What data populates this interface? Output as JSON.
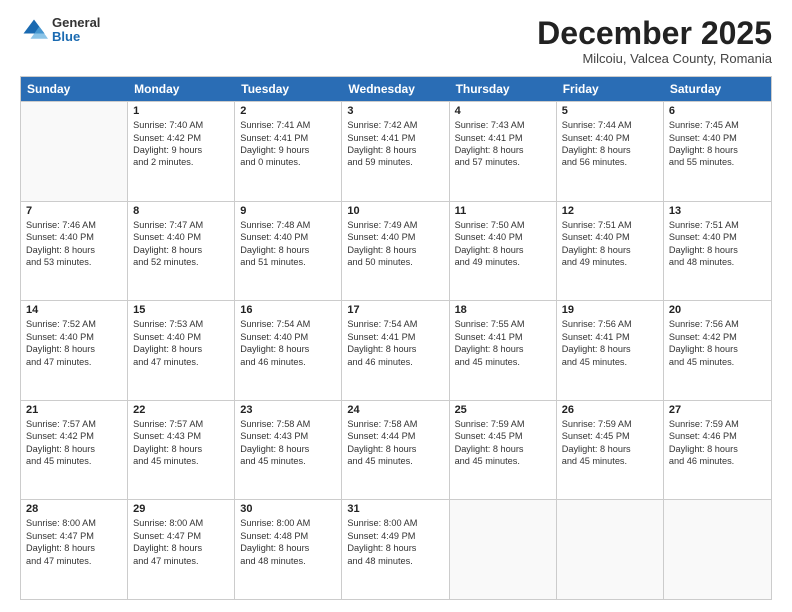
{
  "logo": {
    "general": "General",
    "blue": "Blue"
  },
  "title": "December 2025",
  "subtitle": "Milcoiu, Valcea County, Romania",
  "header_days": [
    "Sunday",
    "Monday",
    "Tuesday",
    "Wednesday",
    "Thursday",
    "Friday",
    "Saturday"
  ],
  "weeks": [
    [
      {
        "day": "",
        "sunrise": "",
        "sunset": "",
        "daylight": ""
      },
      {
        "day": "1",
        "sunrise": "Sunrise: 7:40 AM",
        "sunset": "Sunset: 4:42 PM",
        "daylight": "Daylight: 9 hours and 2 minutes."
      },
      {
        "day": "2",
        "sunrise": "Sunrise: 7:41 AM",
        "sunset": "Sunset: 4:41 PM",
        "daylight": "Daylight: 9 hours and 0 minutes."
      },
      {
        "day": "3",
        "sunrise": "Sunrise: 7:42 AM",
        "sunset": "Sunset: 4:41 PM",
        "daylight": "Daylight: 8 hours and 59 minutes."
      },
      {
        "day": "4",
        "sunrise": "Sunrise: 7:43 AM",
        "sunset": "Sunset: 4:41 PM",
        "daylight": "Daylight: 8 hours and 57 minutes."
      },
      {
        "day": "5",
        "sunrise": "Sunrise: 7:44 AM",
        "sunset": "Sunset: 4:40 PM",
        "daylight": "Daylight: 8 hours and 56 minutes."
      },
      {
        "day": "6",
        "sunrise": "Sunrise: 7:45 AM",
        "sunset": "Sunset: 4:40 PM",
        "daylight": "Daylight: 8 hours and 55 minutes."
      }
    ],
    [
      {
        "day": "7",
        "sunrise": "Sunrise: 7:46 AM",
        "sunset": "Sunset: 4:40 PM",
        "daylight": "Daylight: 8 hours and 53 minutes."
      },
      {
        "day": "8",
        "sunrise": "Sunrise: 7:47 AM",
        "sunset": "Sunset: 4:40 PM",
        "daylight": "Daylight: 8 hours and 52 minutes."
      },
      {
        "day": "9",
        "sunrise": "Sunrise: 7:48 AM",
        "sunset": "Sunset: 4:40 PM",
        "daylight": "Daylight: 8 hours and 51 minutes."
      },
      {
        "day": "10",
        "sunrise": "Sunrise: 7:49 AM",
        "sunset": "Sunset: 4:40 PM",
        "daylight": "Daylight: 8 hours and 50 minutes."
      },
      {
        "day": "11",
        "sunrise": "Sunrise: 7:50 AM",
        "sunset": "Sunset: 4:40 PM",
        "daylight": "Daylight: 8 hours and 49 minutes."
      },
      {
        "day": "12",
        "sunrise": "Sunrise: 7:51 AM",
        "sunset": "Sunset: 4:40 PM",
        "daylight": "Daylight: 8 hours and 49 minutes."
      },
      {
        "day": "13",
        "sunrise": "Sunrise: 7:51 AM",
        "sunset": "Sunset: 4:40 PM",
        "daylight": "Daylight: 8 hours and 48 minutes."
      }
    ],
    [
      {
        "day": "14",
        "sunrise": "Sunrise: 7:52 AM",
        "sunset": "Sunset: 4:40 PM",
        "daylight": "Daylight: 8 hours and 47 minutes."
      },
      {
        "day": "15",
        "sunrise": "Sunrise: 7:53 AM",
        "sunset": "Sunset: 4:40 PM",
        "daylight": "Daylight: 8 hours and 47 minutes."
      },
      {
        "day": "16",
        "sunrise": "Sunrise: 7:54 AM",
        "sunset": "Sunset: 4:40 PM",
        "daylight": "Daylight: 8 hours and 46 minutes."
      },
      {
        "day": "17",
        "sunrise": "Sunrise: 7:54 AM",
        "sunset": "Sunset: 4:41 PM",
        "daylight": "Daylight: 8 hours and 46 minutes."
      },
      {
        "day": "18",
        "sunrise": "Sunrise: 7:55 AM",
        "sunset": "Sunset: 4:41 PM",
        "daylight": "Daylight: 8 hours and 45 minutes."
      },
      {
        "day": "19",
        "sunrise": "Sunrise: 7:56 AM",
        "sunset": "Sunset: 4:41 PM",
        "daylight": "Daylight: 8 hours and 45 minutes."
      },
      {
        "day": "20",
        "sunrise": "Sunrise: 7:56 AM",
        "sunset": "Sunset: 4:42 PM",
        "daylight": "Daylight: 8 hours and 45 minutes."
      }
    ],
    [
      {
        "day": "21",
        "sunrise": "Sunrise: 7:57 AM",
        "sunset": "Sunset: 4:42 PM",
        "daylight": "Daylight: 8 hours and 45 minutes."
      },
      {
        "day": "22",
        "sunrise": "Sunrise: 7:57 AM",
        "sunset": "Sunset: 4:43 PM",
        "daylight": "Daylight: 8 hours and 45 minutes."
      },
      {
        "day": "23",
        "sunrise": "Sunrise: 7:58 AM",
        "sunset": "Sunset: 4:43 PM",
        "daylight": "Daylight: 8 hours and 45 minutes."
      },
      {
        "day": "24",
        "sunrise": "Sunrise: 7:58 AM",
        "sunset": "Sunset: 4:44 PM",
        "daylight": "Daylight: 8 hours and 45 minutes."
      },
      {
        "day": "25",
        "sunrise": "Sunrise: 7:59 AM",
        "sunset": "Sunset: 4:45 PM",
        "daylight": "Daylight: 8 hours and 45 minutes."
      },
      {
        "day": "26",
        "sunrise": "Sunrise: 7:59 AM",
        "sunset": "Sunset: 4:45 PM",
        "daylight": "Daylight: 8 hours and 45 minutes."
      },
      {
        "day": "27",
        "sunrise": "Sunrise: 7:59 AM",
        "sunset": "Sunset: 4:46 PM",
        "daylight": "Daylight: 8 hours and 46 minutes."
      }
    ],
    [
      {
        "day": "28",
        "sunrise": "Sunrise: 8:00 AM",
        "sunset": "Sunset: 4:47 PM",
        "daylight": "Daylight: 8 hours and 47 minutes."
      },
      {
        "day": "29",
        "sunrise": "Sunrise: 8:00 AM",
        "sunset": "Sunset: 4:47 PM",
        "daylight": "Daylight: 8 hours and 47 minutes."
      },
      {
        "day": "30",
        "sunrise": "Sunrise: 8:00 AM",
        "sunset": "Sunset: 4:48 PM",
        "daylight": "Daylight: 8 hours and 48 minutes."
      },
      {
        "day": "31",
        "sunrise": "Sunrise: 8:00 AM",
        "sunset": "Sunset: 4:49 PM",
        "daylight": "Daylight: 8 hours and 48 minutes."
      },
      {
        "day": "",
        "sunrise": "",
        "sunset": "",
        "daylight": ""
      },
      {
        "day": "",
        "sunrise": "",
        "sunset": "",
        "daylight": ""
      },
      {
        "day": "",
        "sunrise": "",
        "sunset": "",
        "daylight": ""
      }
    ]
  ]
}
